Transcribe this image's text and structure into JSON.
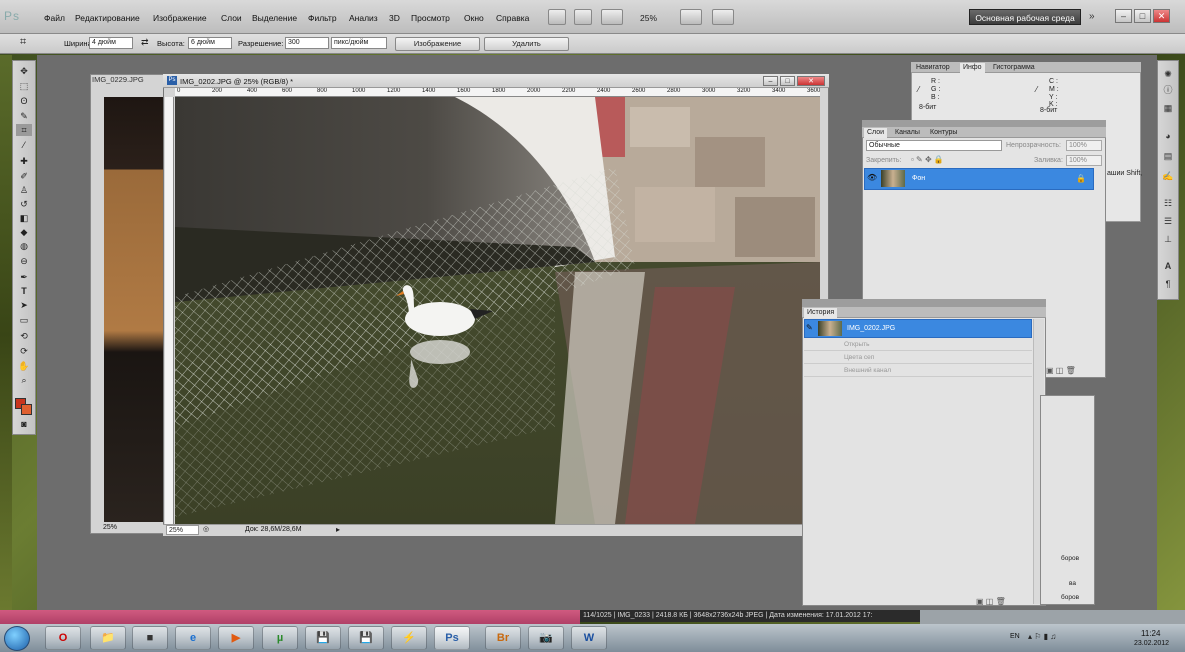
{
  "app": {
    "logo": "Ps"
  },
  "menu": [
    "Файл",
    "Редактирование",
    "Изображение",
    "Слои",
    "Выделение",
    "Фильтр",
    "Анализ",
    "3D",
    "Просмотр",
    "Окно",
    "Справка"
  ],
  "menubar": {
    "zoom": "25%",
    "workspace": "Основная рабочая среда",
    "more": "»"
  },
  "options": {
    "width_label": "Ширина:",
    "width_value": "4 дюйм",
    "height_label": "Высота:",
    "height_value": "6 дюйм",
    "resolution_label": "Разрешение:",
    "resolution_value": "300",
    "resolution_unit": "пикс/дюйм",
    "image_button": "Изображение",
    "clear_button": "Удалить"
  },
  "doc2": {
    "title": "IMG_0229.JPG",
    "zoom": "25%"
  },
  "doc1": {
    "title": "IMG_0202.JPG @ 25% (RGB/8) *",
    "zoom": "25%",
    "doc_size": "Док: 28,6M/28,6M",
    "ruler_ticks": [
      "0",
      "200",
      "400",
      "600",
      "800",
      "1000",
      "1200",
      "1400",
      "1600",
      "1800",
      "2000",
      "2200",
      "2400",
      "2600",
      "2800",
      "3000",
      "3200",
      "3400",
      "3600"
    ]
  },
  "info_panel": {
    "tabs": [
      "Навигатор",
      "Инфо",
      "Гистограмма"
    ],
    "r": "R :",
    "g": "G :",
    "b": "B :",
    "bits_left": "8-бит",
    "c": "C :",
    "m": "M :",
    "y": "Y :",
    "k": "K :",
    "bits_right": "8-бит",
    "hint": "ашии Shift,"
  },
  "layers_panel": {
    "tabs": [
      "Слои",
      "Каналы",
      "Контуры"
    ],
    "blend_mode": "Обычные",
    "opacity_label": "Непрозрачность:",
    "opacity_value": "100%",
    "lock_label": "Закрепить:",
    "fill_label": "Заливка:",
    "fill_value": "100%",
    "layer_name": "Фон"
  },
  "history_panel": {
    "tab": "История",
    "snapshot": "IMG_0202.JPG",
    "items": [
      "Открыть",
      "Цвета сеп",
      "Внешний канал"
    ]
  },
  "adj_panel": {
    "items": [
      "боров",
      "ва",
      "боров"
    ]
  },
  "status_strip": "114/1025 | IMG_0233 | 2418.8 КБ | 3648x2736x24b JPEG | Дата изменения: 17.01.2012 17:",
  "taskbar": {
    "apps": [
      "O",
      "📁",
      "■",
      "e",
      "▶",
      "µ",
      "💾",
      "💾",
      "⚡",
      "Ps",
      "Br",
      "📷",
      "W"
    ],
    "active_app": "Ps",
    "lang": "EN",
    "time": "11:24",
    "date": "23.02.2012"
  },
  "colors": {
    "foreground": "#c8351e",
    "background": "#e06030",
    "accent": "#3b88e0"
  }
}
